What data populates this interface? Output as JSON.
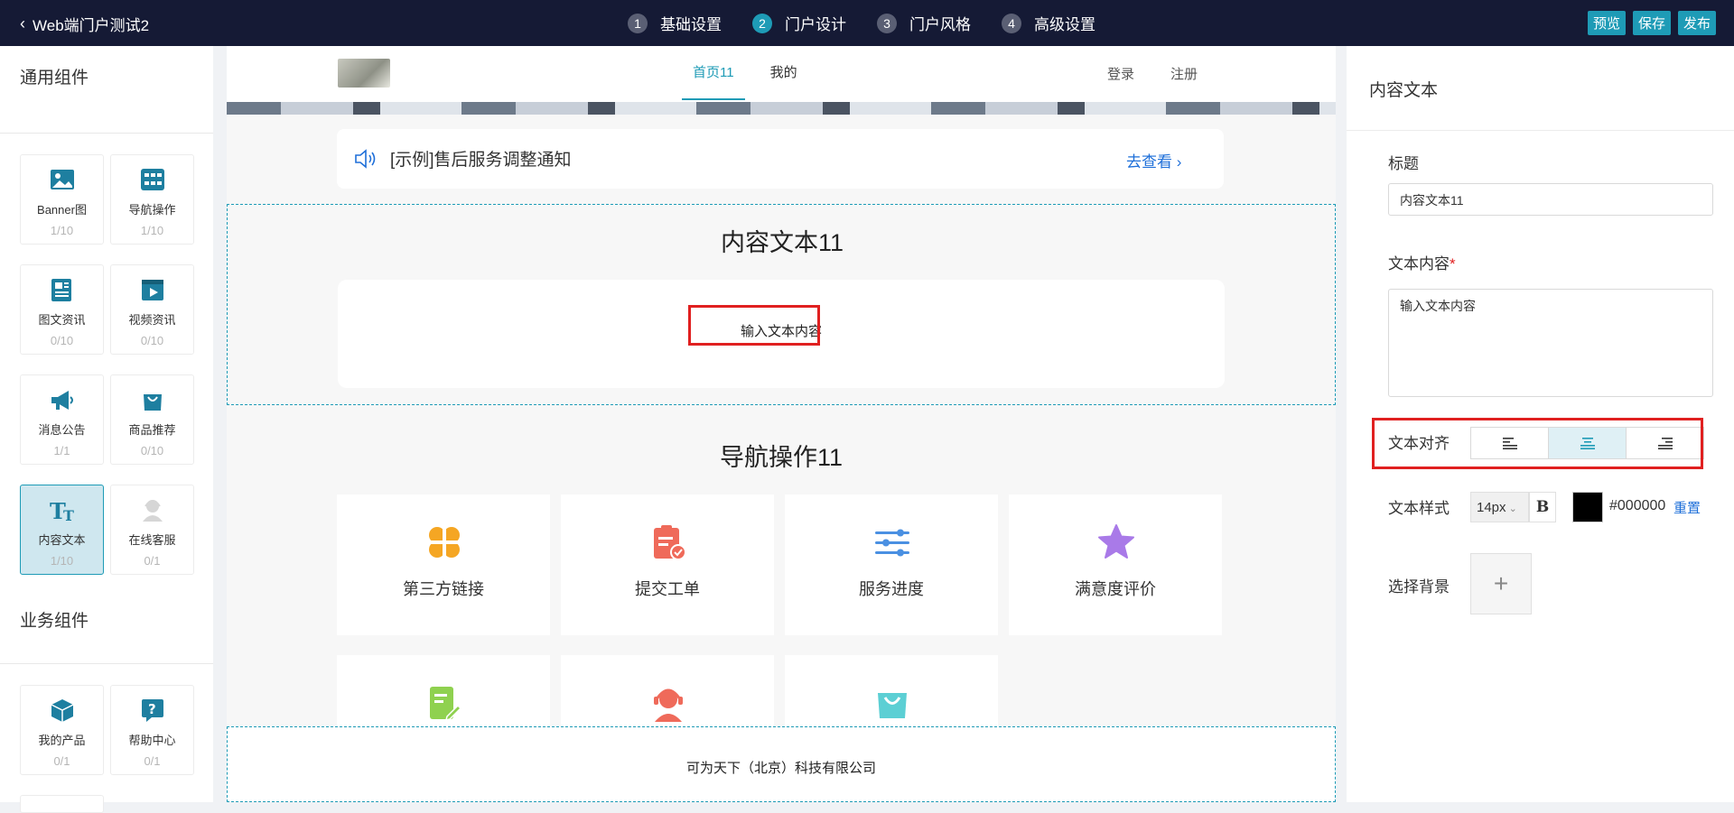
{
  "topbar": {
    "back_label": "Web端门户测试2",
    "steps": [
      {
        "num": "1",
        "label": "基础设置"
      },
      {
        "num": "2",
        "label": "门户设计"
      },
      {
        "num": "3",
        "label": "门户风格"
      },
      {
        "num": "4",
        "label": "高级设置"
      }
    ],
    "active_step": 2,
    "actions": [
      "预览",
      "保存",
      "发布"
    ]
  },
  "sidebar": {
    "general_title": "通用组件",
    "business_title": "业务组件",
    "general_items": [
      {
        "name": "Banner图",
        "count": "1/10",
        "icon": "image-icon"
      },
      {
        "name": "导航操作",
        "count": "1/10",
        "icon": "nav-grid-icon"
      },
      {
        "name": "图文资讯",
        "count": "0/10",
        "icon": "article-icon"
      },
      {
        "name": "视频资讯",
        "count": "0/10",
        "icon": "video-icon"
      },
      {
        "name": "消息公告",
        "count": "1/1",
        "icon": "megaphone-icon"
      },
      {
        "name": "商品推荐",
        "count": "0/10",
        "icon": "shopping-bag-icon"
      },
      {
        "name": "内容文本",
        "count": "1/10",
        "icon": "text-icon"
      },
      {
        "name": "在线客服",
        "count": "0/1",
        "icon": "agent-icon"
      }
    ],
    "business_items": [
      {
        "name": "我的产品",
        "count": "0/1",
        "icon": "cube-icon"
      },
      {
        "name": "帮助中心",
        "count": "0/1",
        "icon": "help-icon"
      }
    ]
  },
  "canvas": {
    "nav": [
      "首页11",
      "我的"
    ],
    "auth": [
      "登录",
      "注册"
    ],
    "notice_text": "[示例]售后服务调整通知",
    "notice_more": "去查看",
    "text_block_title": "内容文本11",
    "text_block_content": "输入文本内容",
    "nav_block_title": "导航操作11",
    "nav_items": [
      "第三方链接",
      "提交工单",
      "服务进度",
      "满意度评价"
    ],
    "footer_text": "可为天下（北京）科技有限公司"
  },
  "panel": {
    "title": "内容文本",
    "title_label": "标题",
    "title_value": "内容文本11",
    "content_label": "文本内容",
    "content_value": "输入文本内容",
    "align_label": "文本对齐",
    "align_selected": "center",
    "style_label": "文本样式",
    "font_size": "14px",
    "bold_label": "B",
    "color_value": "#000000",
    "reset_label": "重置",
    "bg_label": "选择背景",
    "add_label": "+"
  },
  "colors": {
    "accent": "#1e9bb6",
    "topbar": "#151a35",
    "highlight": "#e02020",
    "link": "#1e6fd9"
  }
}
